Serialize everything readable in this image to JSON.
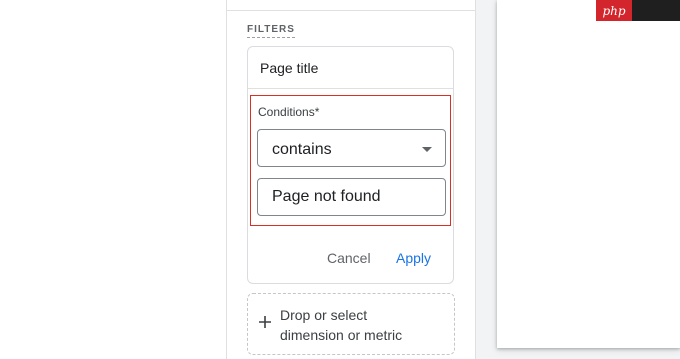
{
  "brand": {
    "badge_label": "php",
    "badge_color": "#d3262c"
  },
  "filters": {
    "section_label": "FILTERS",
    "card": {
      "title": "Page title",
      "conditions_label": "Conditions*",
      "condition_value": "contains",
      "input_value": "Page not found",
      "cancel_label": "Cancel",
      "apply_label": "Apply"
    },
    "drop_zone_line1": "Drop or select",
    "drop_zone_line2": "dimension or metric"
  },
  "colors": {
    "accent": "#1a73e8",
    "error_outline": "#d93025"
  },
  "icons": [
    "chevron-down-icon",
    "plus-icon"
  ]
}
